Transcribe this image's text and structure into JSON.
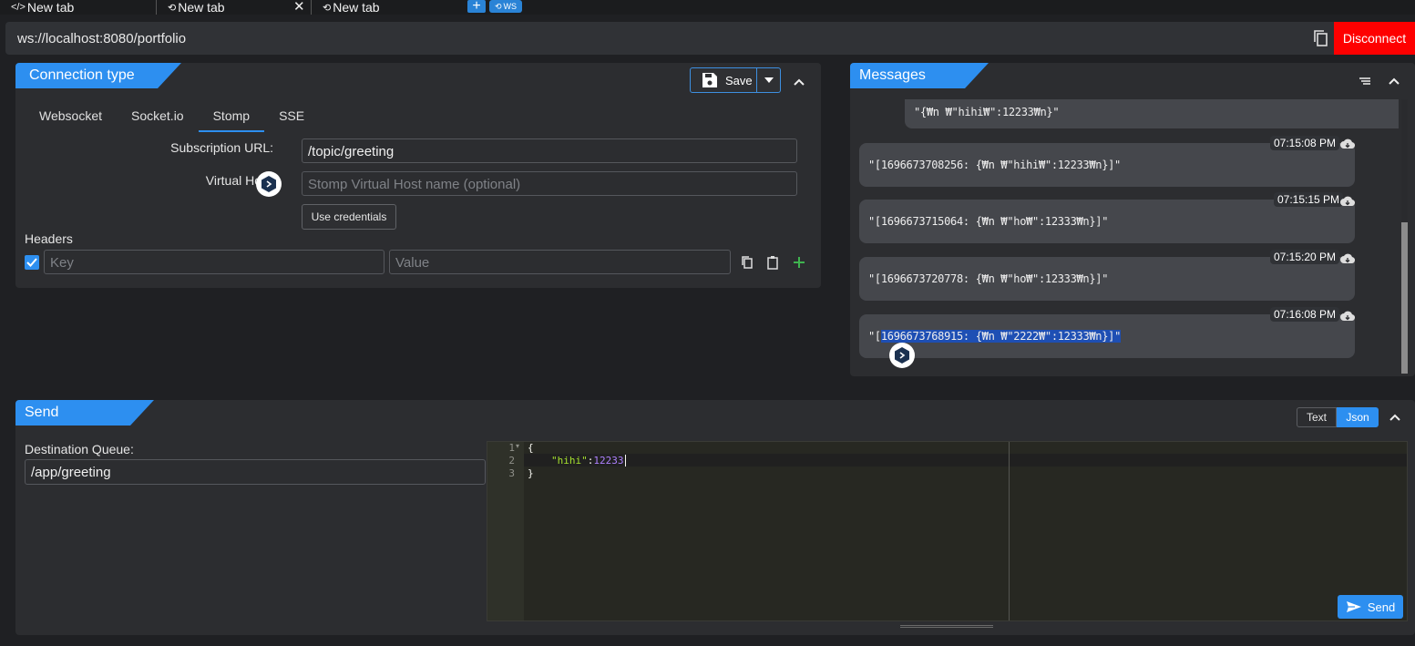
{
  "tabs": [
    {
      "label": "New tab",
      "icon": "code-icon"
    },
    {
      "label": "New tab",
      "icon": "websocket-icon"
    },
    {
      "label": "New tab",
      "icon": "websocket-icon"
    }
  ],
  "ws_badge": "WS",
  "url": "ws://localhost:8080/portfolio",
  "disconnect_label": "Disconnect",
  "connection": {
    "title": "Connection type",
    "save_label": "Save",
    "tabs": [
      "Websocket",
      "Socket.io",
      "Stomp",
      "SSE"
    ],
    "active_tab": "Stomp",
    "subscription_label": "Subscription URL:",
    "subscription_value": "/topic/greeting",
    "virtual_host_label": "Virtual Ho",
    "virtual_host_placeholder": "Stomp Virtual Host name (optional)",
    "credentials_label": "Use credentials",
    "headers_label": "Headers",
    "key_placeholder": "Key",
    "value_placeholder": "Value"
  },
  "messages": {
    "title": "Messages",
    "items": [
      {
        "time": "",
        "text": "\"{₩n    ₩\"hihi₩\":12233₩n}\""
      },
      {
        "time": "07:15:08 PM",
        "text": "\"[1696673708256: {₩n    ₩\"hihi₩\":12233₩n}]\""
      },
      {
        "time": "07:15:15 PM",
        "text": "\"[1696673715064: {₩n    ₩\"ho₩\":12333₩n}]\""
      },
      {
        "time": "07:15:20 PM",
        "text": "\"[1696673720778: {₩n    ₩\"ho₩\":12333₩n}]\""
      },
      {
        "time": "07:16:08 PM",
        "text_plain": "\"[",
        "text_selected": "1696673768915: {₩n    ₩\"2222₩\":12333₩n}]\""
      }
    ]
  },
  "send": {
    "title": "Send",
    "mode_text": "Text",
    "mode_json": "Json",
    "active_mode": "Json",
    "destination_label": "Destination Queue:",
    "destination_value": "/app/greeting",
    "editor_lines": [
      "1",
      "2",
      "3"
    ],
    "code_line1": "{",
    "code_key": "\"hihi\"",
    "code_colon": ":",
    "code_value": "12233",
    "code_line3": "}",
    "send_label": "Send"
  },
  "colors": {
    "accent": "#2d8ff0",
    "disconnect": "#fe0000",
    "selection": "#1e4fb4"
  }
}
